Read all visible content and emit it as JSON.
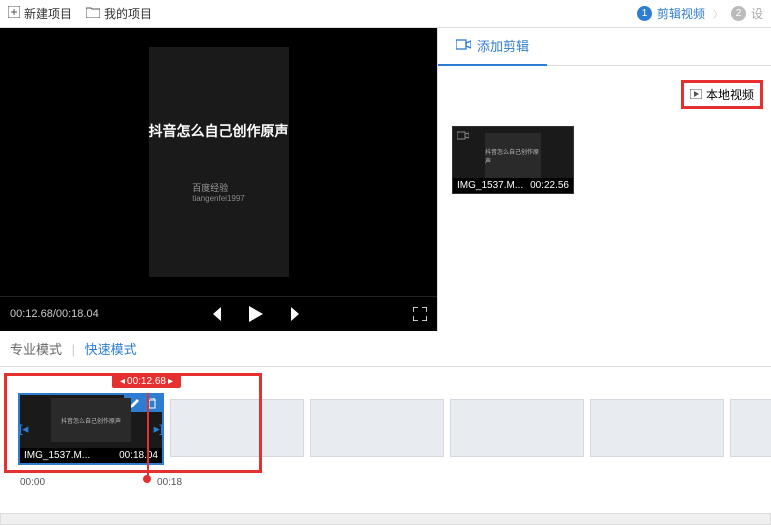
{
  "topbar": {
    "new_project": "新建项目",
    "my_projects": "我的项目"
  },
  "steps": {
    "s1": {
      "num": "1",
      "label": "剪辑视频"
    },
    "s2": {
      "num": "2",
      "label": "设"
    }
  },
  "player": {
    "video_text": "抖音怎么自己创作原声",
    "sub1": "百度经验",
    "sub2": "tiangenfei1997",
    "time": "00:12.68/00:18.04"
  },
  "panel": {
    "tab_add": "添加剪辑",
    "local_video": "本地视频",
    "clip": {
      "name": "IMG_1537.M...",
      "dur": "00:22.56",
      "txt": "抖音怎么自己创作原声"
    }
  },
  "modes": {
    "pro": "专业模式",
    "quick": "快速模式"
  },
  "timeline": {
    "playhead": "00:12.68",
    "clip": {
      "name": "IMG_1537.M...",
      "dur": "00:18.04",
      "txt": "抖音怎么自己创作原声"
    },
    "ruler": [
      "00:00",
      "00:18"
    ]
  }
}
